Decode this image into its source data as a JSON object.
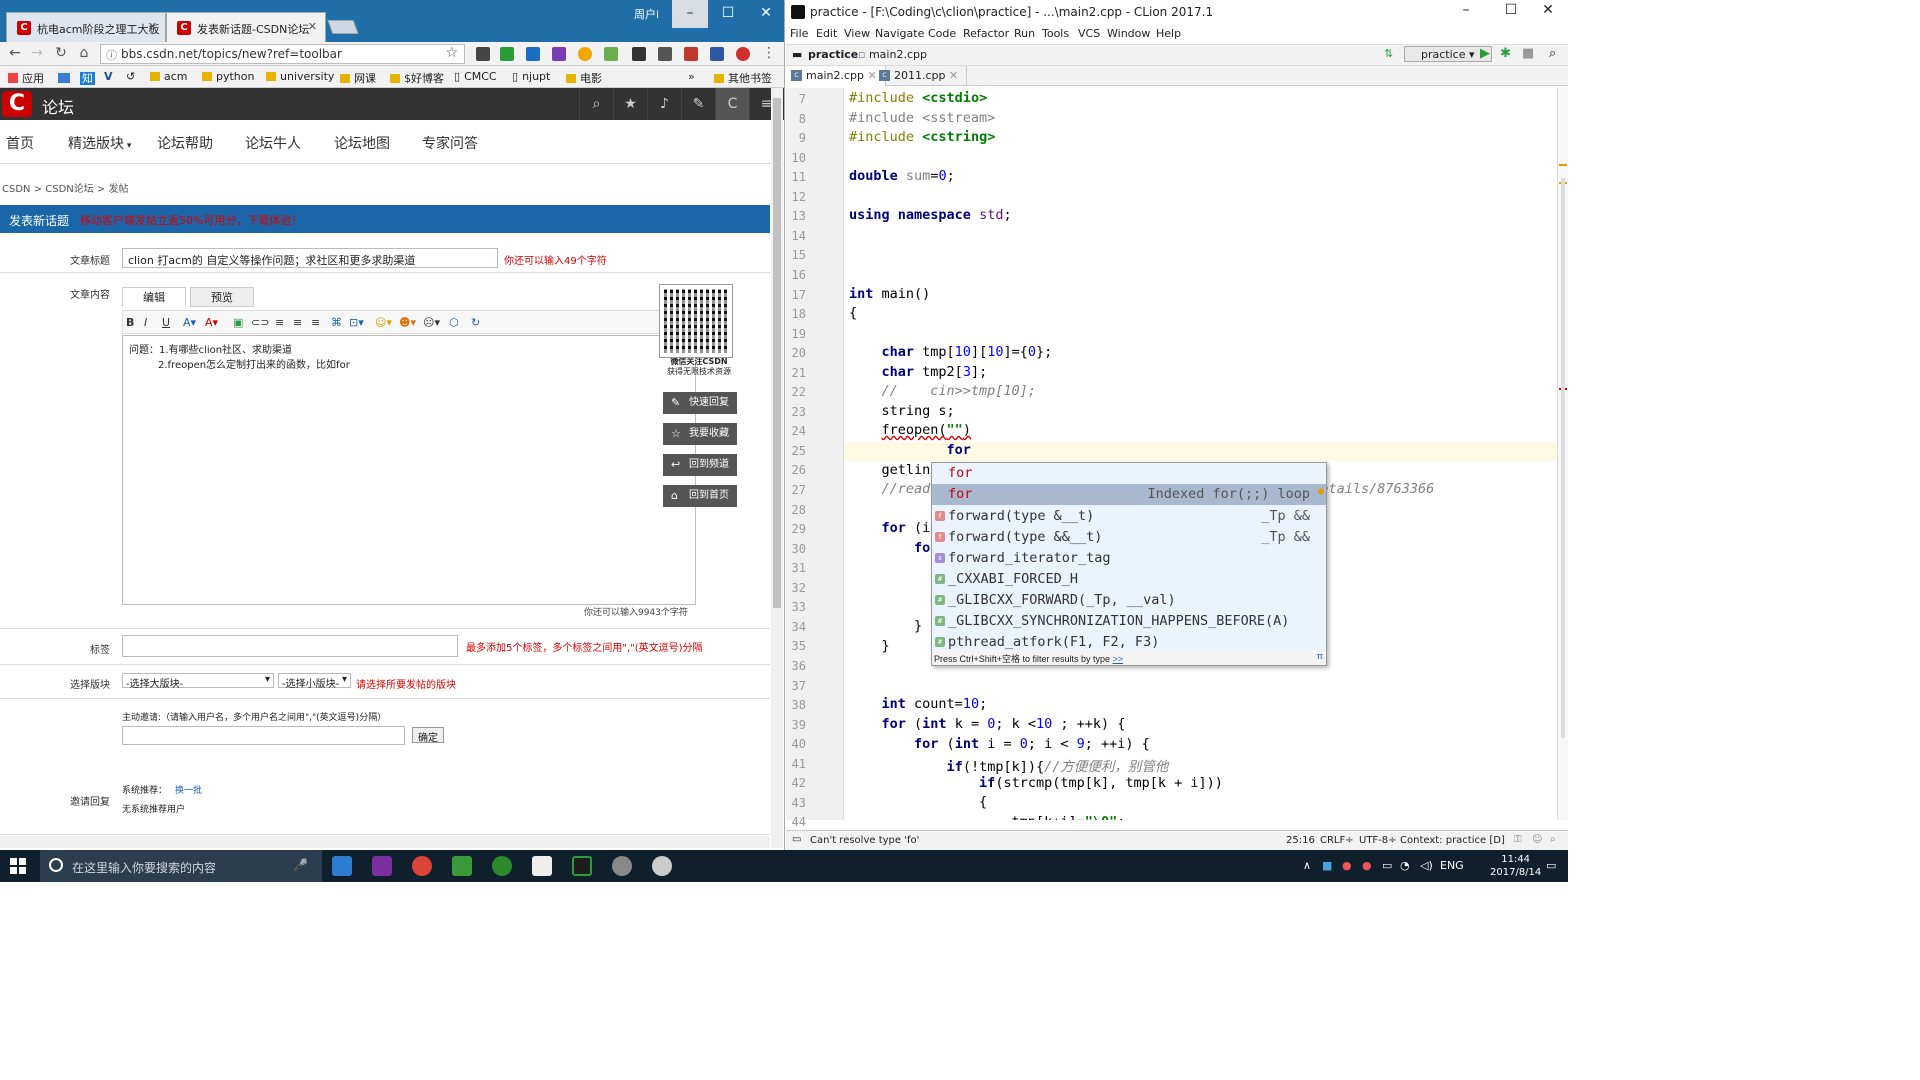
{
  "browser": {
    "tabs": [
      {
        "label": "杭电acm阶段之理工大板"
      },
      {
        "label": "发表新话题-CSDN论坛"
      }
    ],
    "profile": "周户i",
    "url": "bbs.csdn.net/topics/new?ref=toolbar",
    "bookmarks": [
      "应用",
      "知",
      "acm",
      "python",
      "university",
      "网课",
      "$好博客",
      "CMCC",
      "njupt",
      "电影",
      "»",
      "其他书签"
    ]
  },
  "csdn": {
    "logo": "C",
    "section": "论坛",
    "nav": [
      "首页",
      "精选版块",
      "论坛帮助",
      "论坛牛人",
      "论坛地图",
      "专家问答"
    ],
    "breadcrumb": "CSDN > CSDN论坛 > 发帖",
    "banner_title": "发表新话题",
    "banner_notice": "移动客户端发帖立返50%可用分，下载体验！",
    "title_label": "文章标题",
    "title_value": "clion 打acm的 自定义等操作问题；求社区和更多求助渠道",
    "title_hint": "你还可以输入49个字符",
    "content_label": "文章内容",
    "tab_edit": "编辑",
    "tab_preview": "预览",
    "content_lines": [
      "问题：1.有哪些clion社区、求助渠道",
      "2.freopen怎么定制打出来的函数，比如for"
    ],
    "content_hint": "你还可以输入9943个字符",
    "qr_caption1": "微信关注CSDN",
    "qr_caption2": "获得无限技术资源",
    "side_buttons": [
      "快速回复",
      "我要收藏",
      "回到频道",
      "回到首页"
    ],
    "tags_label": "标签",
    "tags_hint": "最多添加5个标签，多个标签之间用\",\"(英文逗号)分隔",
    "board_label": "选择版块",
    "board_major": "-选择大版块-",
    "board_minor": "-选择小版块-",
    "board_hint": "请选择所要发帖的版块",
    "invite_label": "邀请回复",
    "invite_text": "主动邀请:（请输入用户名，多个用户名之间用\",\"(英文逗号)分隔）",
    "invite_confirm": "确定",
    "recommend_label": "系统推荐：",
    "recommend_link": "换一批",
    "no_recommend": "无系统推荐用户"
  },
  "clion": {
    "title": "practice - [F:\\Coding\\c\\clion\\practice] - ...\\main2.cpp - CLion 2017.1",
    "menu": [
      "File",
      "Edit",
      "View",
      "Navigate",
      "Code",
      "Refactor",
      "Run",
      "Tools",
      "VCS",
      "Window",
      "Help"
    ],
    "nav_project": "practice",
    "nav_file": "main2.cpp",
    "run_config": "practice",
    "tabs": [
      "main2.cpp",
      "2011.cpp"
    ],
    "line_numbers": [
      "7",
      "8",
      "9",
      "10",
      "11",
      "12",
      "13",
      "14",
      "15",
      "16",
      "17",
      "18",
      "19",
      "20",
      "21",
      "22",
      "23",
      "24",
      "25",
      "26",
      "27",
      "28",
      "29",
      "30",
      "31",
      "32",
      "33",
      "34",
      "35",
      "36",
      "37",
      "38",
      "39",
      "40",
      "41",
      "42",
      "43",
      "44"
    ],
    "popup_items": [
      {
        "name": "for",
        "type": ""
      },
      {
        "name": "for",
        "type": "Indexed for(;;) loop"
      },
      {
        "name": "forward(type &__t)",
        "type": "_Tp &&"
      },
      {
        "name": "forward(type &&__t)",
        "type": "_Tp &&"
      },
      {
        "name": "forward_iterator_tag",
        "type": ""
      },
      {
        "name": "_CXXABI_FORCED_H",
        "type": ""
      },
      {
        "name": "_GLIBCXX_FORWARD(_Tp, __val)",
        "type": ""
      },
      {
        "name": "_GLIBCXX_SYNCHRONIZATION_HAPPENS_BEFORE(A)",
        "type": ""
      },
      {
        "name": "pthread_atfork(F1, F2, F3)",
        "type": ""
      }
    ],
    "popup_footer": "Press Ctrl+Shift+空格 to filter results by type",
    "popup_footer_link": ">>",
    "status_message": "Can't resolve type 'fo'",
    "status_position": "25:16",
    "status_crlf": "CRLF÷",
    "status_encoding": "UTF-8÷",
    "status_context": "Context: practice [D]"
  },
  "taskbar": {
    "search_placeholder": "在这里输入你要搜索的内容",
    "lang": "ENG",
    "time": "11:44",
    "date": "2017/8/14"
  }
}
